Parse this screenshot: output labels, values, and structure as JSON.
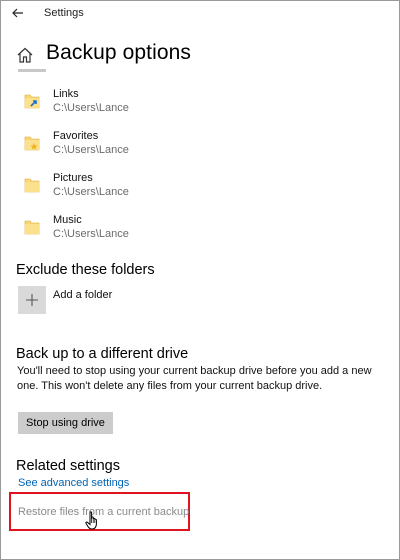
{
  "window": {
    "app_title": "Settings"
  },
  "header": {
    "page_title": "Backup options"
  },
  "folders": [
    {
      "name": "Links",
      "path": "C:\\Users\\Lance",
      "icon": "folder-links-icon"
    },
    {
      "name": "Favorites",
      "path": "C:\\Users\\Lance",
      "icon": "folder-favorites-icon"
    },
    {
      "name": "Pictures",
      "path": "C:\\Users\\Lance",
      "icon": "folder-icon"
    },
    {
      "name": "Music",
      "path": "C:\\Users\\Lance",
      "icon": "folder-icon"
    }
  ],
  "exclude": {
    "title": "Exclude these folders",
    "add_label": "Add a folder"
  },
  "drive": {
    "title": "Back up to a different drive",
    "description": "You'll need to stop using your current backup drive before you add a new one. This won't delete any files from your current backup drive.",
    "stop_button": "Stop using drive"
  },
  "related": {
    "title": "Related settings",
    "advanced_link": "See advanced settings",
    "restore_link": "Restore files from a current backup"
  },
  "colors": {
    "link": "#0063b1",
    "highlight": "#e0141e",
    "folder": "#f8d774"
  }
}
